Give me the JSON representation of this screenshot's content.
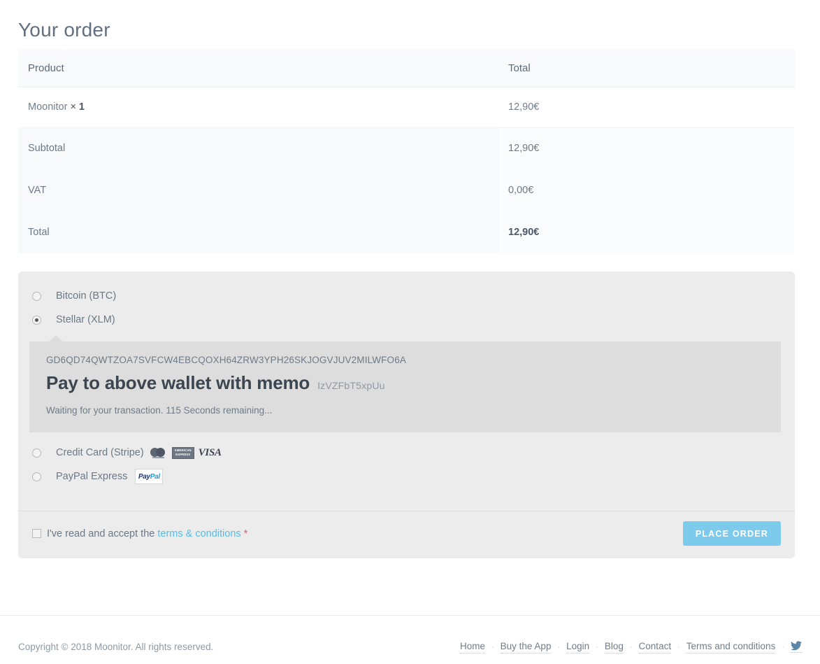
{
  "page": {
    "title": "Your order"
  },
  "order_table": {
    "columns": [
      "Product",
      "Total"
    ],
    "items": [
      {
        "name": "Moonitor",
        "times": "×",
        "qty": "1",
        "total": "12,90€"
      }
    ],
    "summary": [
      {
        "label": "Subtotal",
        "value": "12,90€",
        "emphasis": false
      },
      {
        "label": "VAT",
        "value": "0,00€",
        "emphasis": false
      },
      {
        "label": "Total",
        "value": "12,90€",
        "emphasis": true
      }
    ]
  },
  "payment": {
    "methods": [
      {
        "label": "Bitcoin (BTC)",
        "selected": false,
        "icons": []
      },
      {
        "label": "Stellar (XLM)",
        "selected": true,
        "icons": []
      },
      {
        "label": "Credit Card (Stripe)",
        "selected": false,
        "icons": [
          "mastercard-icon",
          "amex-icon",
          "visa-icon"
        ]
      },
      {
        "label": "PayPal Express",
        "selected": false,
        "icons": [
          "paypal-icon"
        ]
      }
    ],
    "crypto_panel": {
      "wallet_address": "GD6QD74QWTZOA7SVFCW4EBCQOXH64ZRW3YPH26SKJOGVJUV2MILWFO6A",
      "heading": "Pay to above wallet with memo",
      "memo": "IzVZFbT5xpUu",
      "status": "Waiting for your transaction.  115 Seconds remaining...",
      "seconds_remaining": 115
    },
    "amex_lines": [
      "AMERICAN",
      "EXPRESS"
    ],
    "visa_text": "VISA",
    "paypal_text_1": "Pay",
    "paypal_text_2": "Pal"
  },
  "terms": {
    "prefix": "I've read and accept the",
    "link": "terms & conditions",
    "required_mark": "*",
    "checked": false,
    "place_order_label": "PLACE ORDER"
  },
  "footer": {
    "copyright": "Copyright © 2018 Moonitor. All rights reserved.",
    "links": [
      {
        "label": "Home"
      },
      {
        "label": "Buy the App"
      },
      {
        "label": "Login"
      },
      {
        "label": "Blog"
      },
      {
        "label": "Contact"
      },
      {
        "label": "Terms and conditions"
      }
    ],
    "separator": "·",
    "social_icon": "twitter-icon"
  },
  "colors": {
    "accent": "#7ccbec",
    "link": "#55bce8",
    "required": "#f4516c",
    "panel_bg": "#ececed",
    "crypto_bg": "#dddddd"
  }
}
